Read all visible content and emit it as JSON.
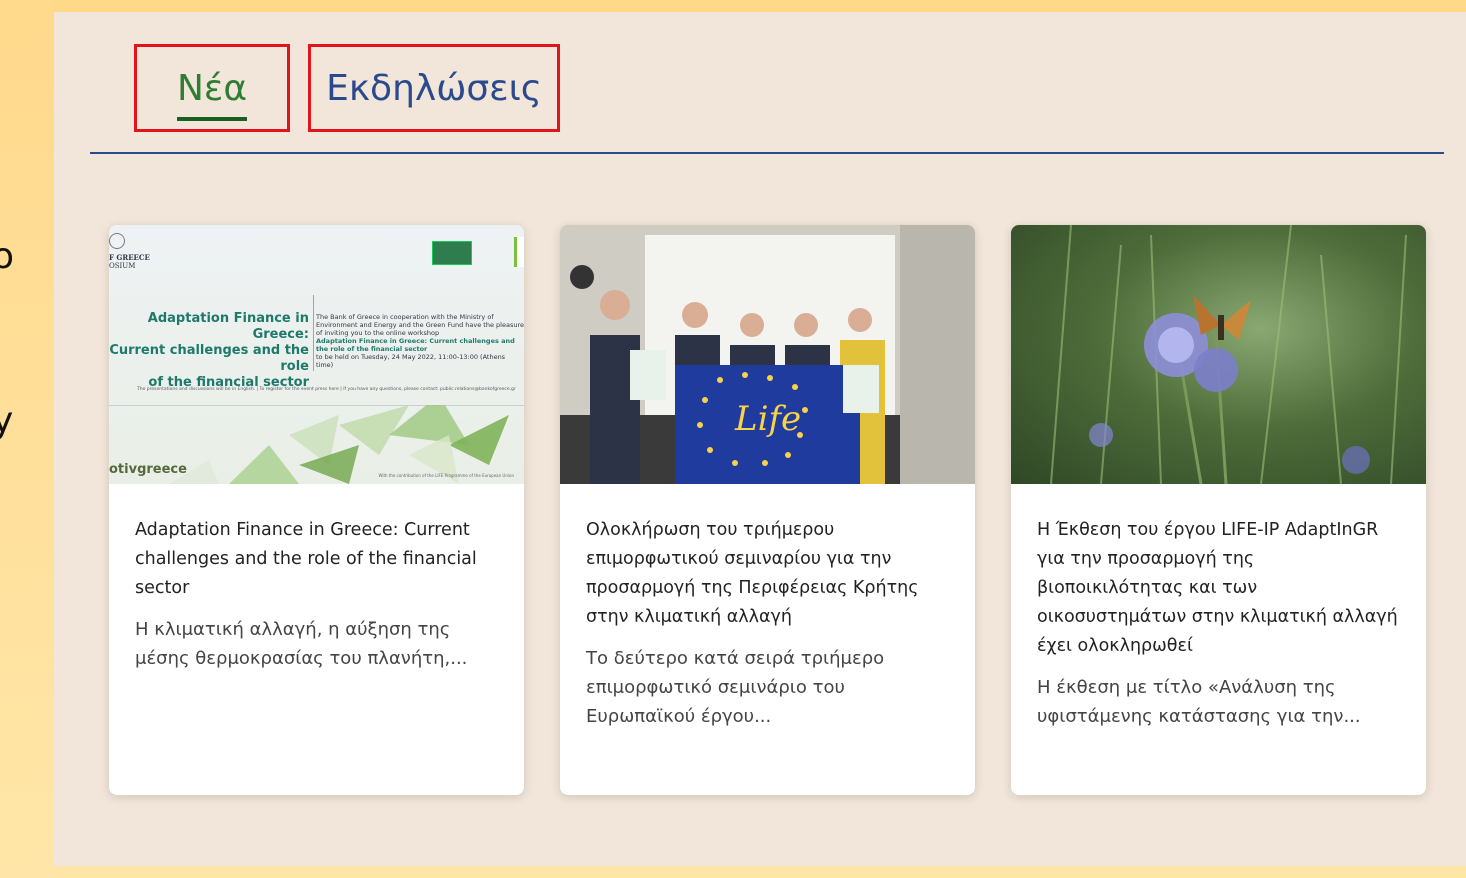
{
  "tabs": [
    {
      "label": "Νέα",
      "active": true
    },
    {
      "label": "Εκδηλώσεις",
      "active": false
    }
  ],
  "left_fragments": [
    "o",
    "y"
  ],
  "colors": {
    "active_tab_text": "#2e7d32",
    "inactive_tab_text": "#2b4a8e",
    "highlight_border": "#e0141a",
    "divider": "#2b4a8e",
    "panel_bg": "#f1e6d9"
  },
  "cards": [
    {
      "title": "Adaptation Finance in Greece: Current challenges and the role of the financial sector",
      "excerpt": "Η κλιματική αλλαγή, η αύξηση της μέσης θερμοκρασίας του πλανήτη,...",
      "image": {
        "header": "F GREECE",
        "header_sub": "OSIUM",
        "title": "Adaptation Finance in Greece:\nCurrent challenges and the role\nof the financial sector",
        "desc_1": "The Bank of Greece in cooperation with the Ministry of Environment and Energy and the Green Fund have the pleasure of inviting you to the online workshop",
        "desc_title": "Adaptation Finance in Greece: Current challenges and the role of the financial sector",
        "desc_date": "to be held on Tuesday, 24 May 2022, 11:00-13:00 (Athens time)",
        "info": "The presentations and discussions will be in English. | To register for the event press here | If you have any questions, please contact: public.relations@bankofgreece.gr",
        "brand": "otivgreece",
        "contrib": "With the contribution of the LIFE Programme of the European Union"
      }
    },
    {
      "title": "Ολοκλήρωση του τριήμερου επιμορφωτικού σεμιναρίου για την προσαρμογή της Περιφέρειας Κρήτης στην κλιματική αλλαγή",
      "excerpt": "Το δεύτερο κατά σειρά τριήμερο επιμορφωτικό σεμινάριο του Ευρωπαϊκού έργου...",
      "image": {
        "flag_text": "Life"
      }
    },
    {
      "title": "Η Έκθεση του έργου LIFE-IP AdaptInGR για την προσαρμογή της βιοποικιλότητας και των οικοσυστημάτων στην κλιματική αλλαγή έχει ολοκληρωθεί",
      "excerpt": "Η έκθεση με τίτλο «Ανάλυση της υφιστάμενης κατάστασης για την...",
      "image": {}
    }
  ]
}
